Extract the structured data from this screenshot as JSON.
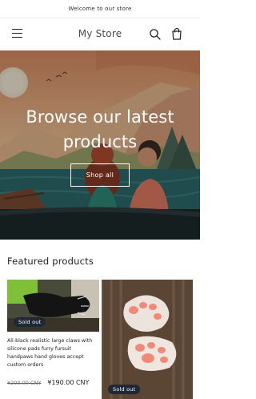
{
  "announcement": {
    "text": "Welcome to our store"
  },
  "header": {
    "store_name": "My Store",
    "icons": {
      "menu": "menu-icon",
      "search": "search-icon",
      "cart": "cart-icon"
    }
  },
  "hero": {
    "heading": "Browse our latest products",
    "button_label": "Shop all"
  },
  "featured": {
    "title": "Featured products",
    "products": [
      {
        "badge": "Sold out",
        "title": "All-black realistic large claws with silicone pads furry fursuit handpaws hand gloves accept custom orders",
        "price_old": "¥200.00 CNY",
        "price_new": "¥190.00 CNY"
      },
      {
        "badge": "Sold out"
      }
    ]
  },
  "colors": {
    "badge_bg": "#1f2837",
    "text": "#121212",
    "hero_sky": "#e8b48a",
    "hero_water": "#2f6a6b"
  }
}
